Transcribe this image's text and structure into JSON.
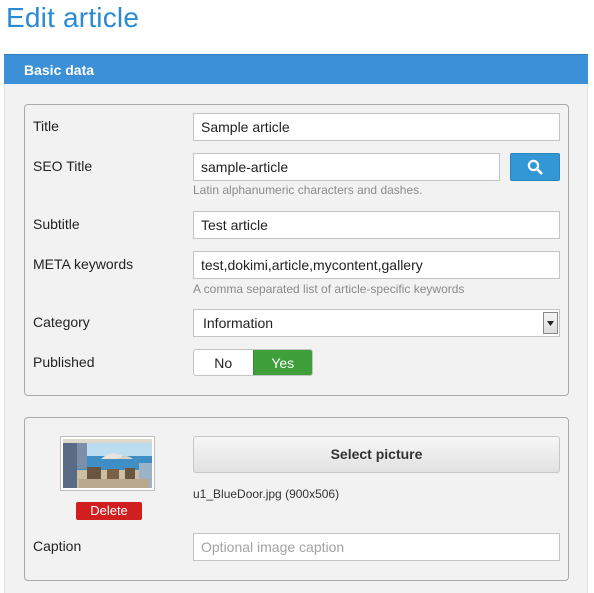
{
  "page": {
    "title": "Edit article"
  },
  "section": {
    "title": "Basic data"
  },
  "fields": {
    "title": {
      "label": "Title",
      "value": "Sample article"
    },
    "seo_title": {
      "label": "SEO Title",
      "value": "sample-article",
      "help": "Latin alphanumeric characters and dashes."
    },
    "subtitle": {
      "label": "Subtitle",
      "value": "Test article"
    },
    "meta_keywords": {
      "label": "META keywords",
      "value": "test,dokimi,article,mycontent,gallery",
      "help": "A comma separated list of article-specific keywords"
    },
    "category": {
      "label": "Category",
      "value": "Information"
    },
    "published": {
      "label": "Published",
      "no_label": "No",
      "yes_label": "Yes",
      "selected": "Yes"
    }
  },
  "picture": {
    "delete_label": "Delete",
    "select_label": "Select picture",
    "file_info": "u1_BlueDoor.jpg (900x506)",
    "caption_label": "Caption",
    "caption_placeholder": "Optional image caption",
    "caption_value": ""
  },
  "icons": {
    "search": "search-icon",
    "dropdown": "chevron-down-icon"
  },
  "colors": {
    "accent": "#2a8ad4",
    "section_bar": "#3b90d8",
    "search_button": "#3497d5",
    "yes_active": "#3f9f3a",
    "delete_button": "#d11f1f"
  }
}
